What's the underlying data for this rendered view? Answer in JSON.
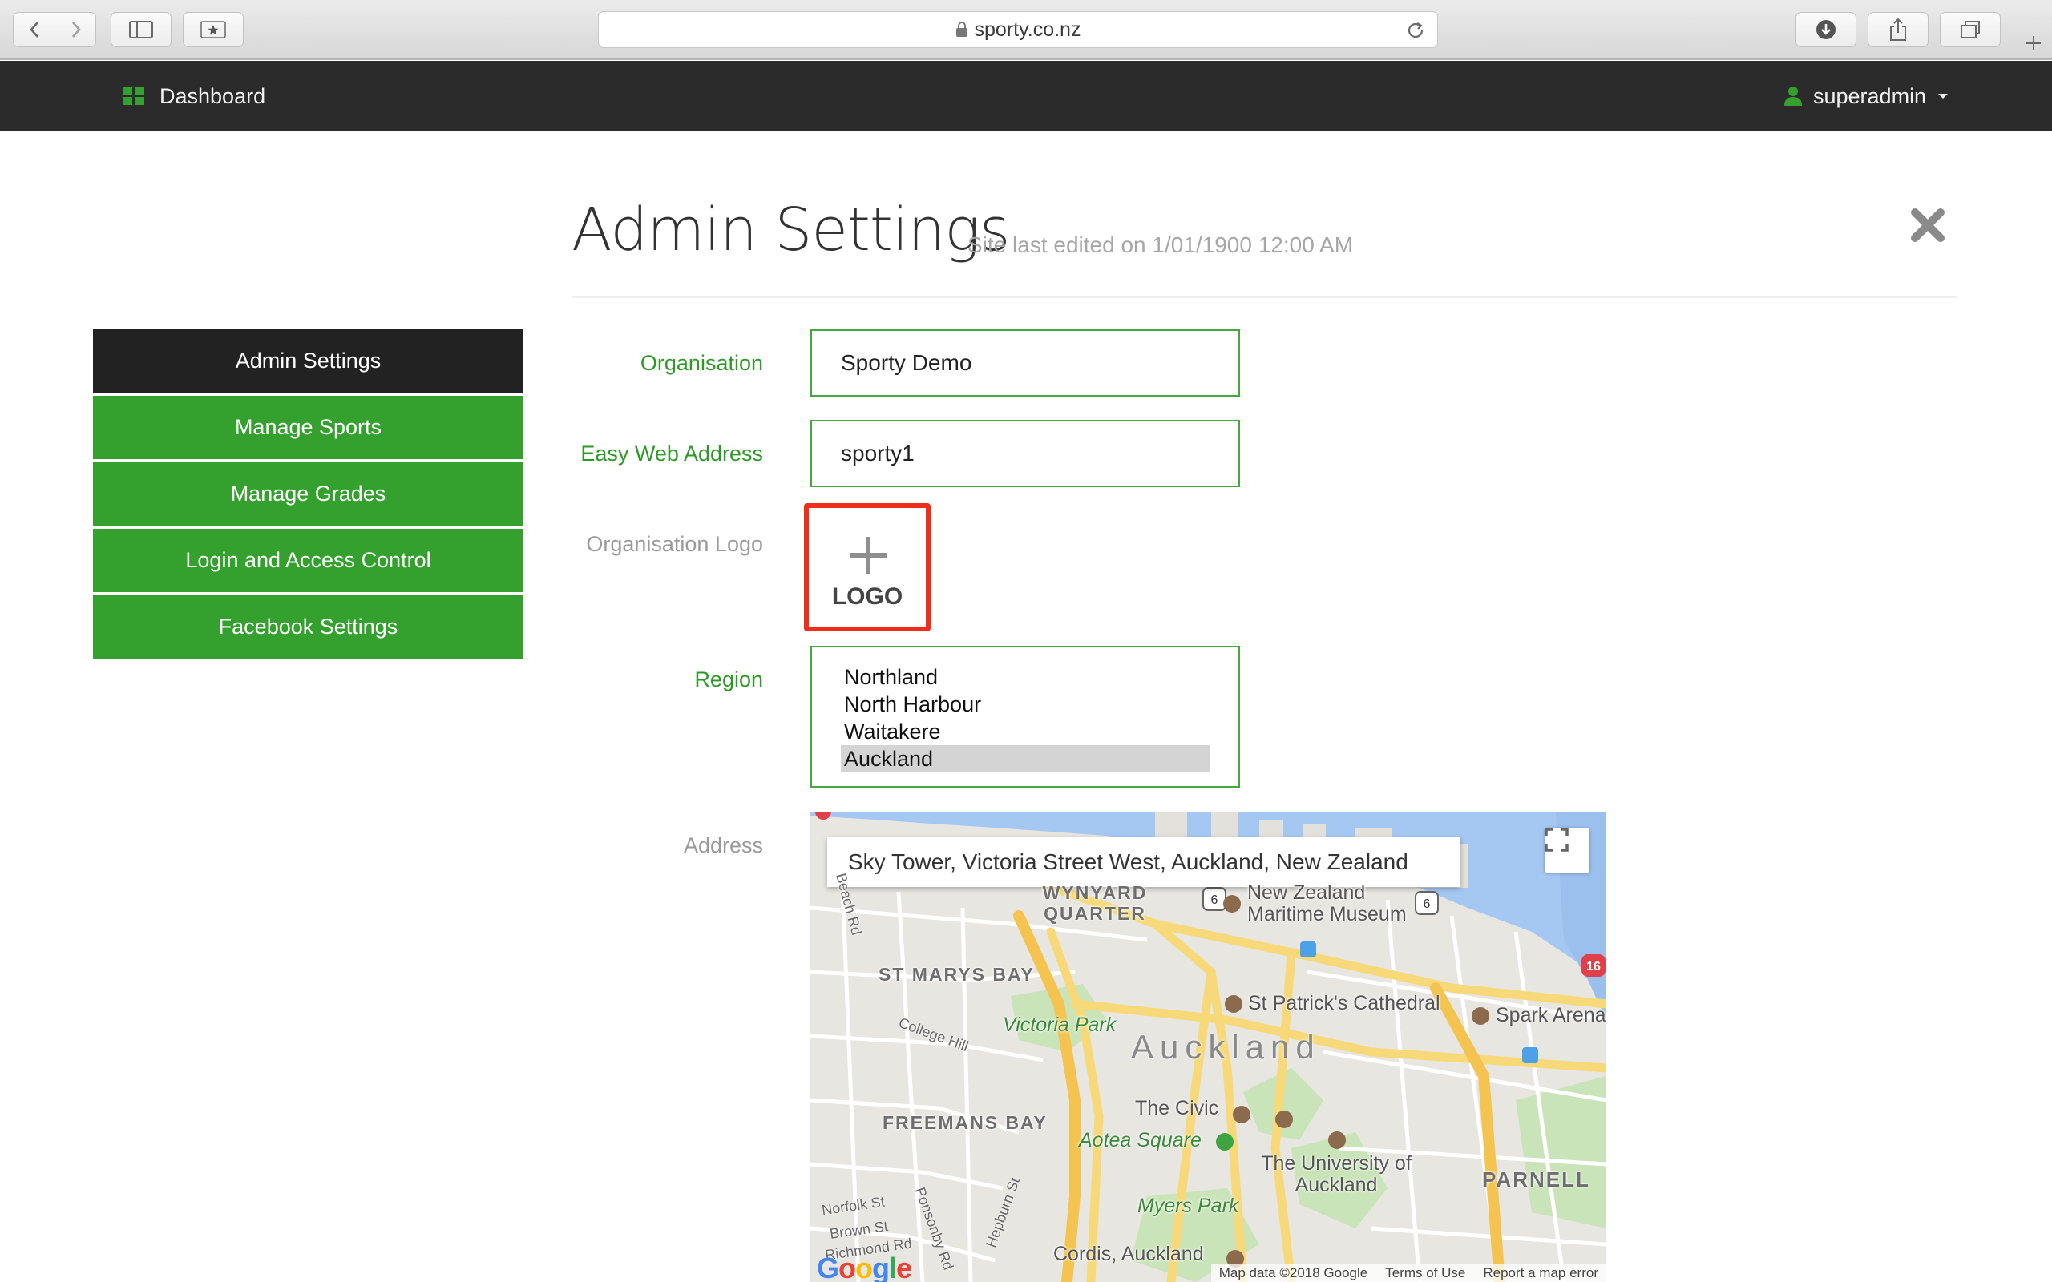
{
  "browser": {
    "url": "sporty.co.nz"
  },
  "navbar": {
    "brand_label": "Dashboard",
    "user_label": "superadmin",
    "accent": "#34a02e"
  },
  "header": {
    "title": "Admin Settings",
    "subtitle": "Site last edited on 1/01/1900 12:00 AM"
  },
  "sidebar": {
    "items": [
      {
        "label": "Admin Settings",
        "active": true
      },
      {
        "label": "Manage Sports",
        "active": false
      },
      {
        "label": "Manage Grades",
        "active": false
      },
      {
        "label": "Login and Access Control",
        "active": false
      },
      {
        "label": "Facebook Settings",
        "active": false
      }
    ]
  },
  "form": {
    "organisation": {
      "label": "Organisation",
      "value": "Sporty Demo"
    },
    "web_address": {
      "label": "Easy Web Address",
      "value": "sporty1"
    },
    "logo": {
      "label": "Organisation Logo",
      "button_text": "LOGO",
      "highlight_color": "#f02c1a"
    },
    "region": {
      "label": "Region",
      "options": [
        "Northland",
        "North Harbour",
        "Waitakere",
        "Auckland"
      ],
      "selected": "Auckland"
    },
    "address": {
      "label": "Address"
    }
  },
  "map": {
    "search_value": "Sky Tower, Victoria Street West, Auckland, New Zealand",
    "labels": {
      "wynyard": "WYNYARD QUARTER",
      "maritime": "New Zealand Maritime Museum",
      "st_marys": "ST MARYS BAY",
      "st_patricks": "St Patrick's Cathedral",
      "spark": "Spark Arena",
      "victoria_park": "Victoria Park",
      "city": "Auckland",
      "freemans": "FREEMANS BAY",
      "civic": "The Civic",
      "aotea": "Aotea Square",
      "university": "The University of Auckland",
      "parnell": "PARNELL",
      "myers": "Myers Park",
      "cordis": "Cordis, Auckland",
      "college_hill": "College Hill",
      "beach_rd": "Beach Rd",
      "ponsonby": "Ponsonby Rd",
      "hepburn": "Hepburn St",
      "norfolk": "Norfolk St",
      "brown": "Brown St",
      "richmond": "Richmond Rd",
      "route6a": "6",
      "route6b": "6",
      "route16": "16"
    },
    "attribution": {
      "data": "Map data ©2018 Google",
      "terms": "Terms of Use",
      "report": "Report a map error"
    },
    "google_logo": "Google"
  }
}
